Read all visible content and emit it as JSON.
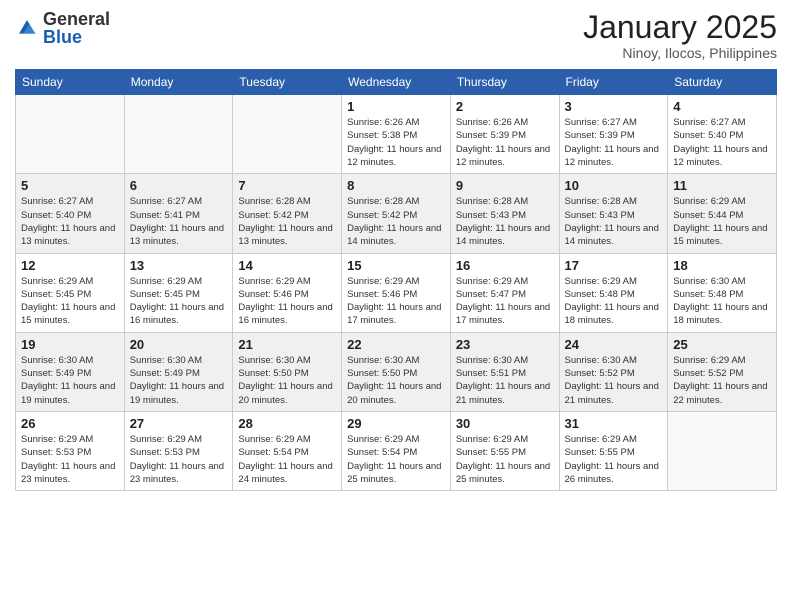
{
  "header": {
    "logo_general": "General",
    "logo_blue": "Blue",
    "month_title": "January 2025",
    "location": "Ninoy, Ilocos, Philippines"
  },
  "weekdays": [
    "Sunday",
    "Monday",
    "Tuesday",
    "Wednesday",
    "Thursday",
    "Friday",
    "Saturday"
  ],
  "weeks": [
    [
      {
        "day": "",
        "sunrise": "",
        "sunset": "",
        "daylight": ""
      },
      {
        "day": "",
        "sunrise": "",
        "sunset": "",
        "daylight": ""
      },
      {
        "day": "",
        "sunrise": "",
        "sunset": "",
        "daylight": ""
      },
      {
        "day": "1",
        "sunrise": "Sunrise: 6:26 AM",
        "sunset": "Sunset: 5:38 PM",
        "daylight": "Daylight: 11 hours and 12 minutes."
      },
      {
        "day": "2",
        "sunrise": "Sunrise: 6:26 AM",
        "sunset": "Sunset: 5:39 PM",
        "daylight": "Daylight: 11 hours and 12 minutes."
      },
      {
        "day": "3",
        "sunrise": "Sunrise: 6:27 AM",
        "sunset": "Sunset: 5:39 PM",
        "daylight": "Daylight: 11 hours and 12 minutes."
      },
      {
        "day": "4",
        "sunrise": "Sunrise: 6:27 AM",
        "sunset": "Sunset: 5:40 PM",
        "daylight": "Daylight: 11 hours and 12 minutes."
      }
    ],
    [
      {
        "day": "5",
        "sunrise": "Sunrise: 6:27 AM",
        "sunset": "Sunset: 5:40 PM",
        "daylight": "Daylight: 11 hours and 13 minutes."
      },
      {
        "day": "6",
        "sunrise": "Sunrise: 6:27 AM",
        "sunset": "Sunset: 5:41 PM",
        "daylight": "Daylight: 11 hours and 13 minutes."
      },
      {
        "day": "7",
        "sunrise": "Sunrise: 6:28 AM",
        "sunset": "Sunset: 5:42 PM",
        "daylight": "Daylight: 11 hours and 13 minutes."
      },
      {
        "day": "8",
        "sunrise": "Sunrise: 6:28 AM",
        "sunset": "Sunset: 5:42 PM",
        "daylight": "Daylight: 11 hours and 14 minutes."
      },
      {
        "day": "9",
        "sunrise": "Sunrise: 6:28 AM",
        "sunset": "Sunset: 5:43 PM",
        "daylight": "Daylight: 11 hours and 14 minutes."
      },
      {
        "day": "10",
        "sunrise": "Sunrise: 6:28 AM",
        "sunset": "Sunset: 5:43 PM",
        "daylight": "Daylight: 11 hours and 14 minutes."
      },
      {
        "day": "11",
        "sunrise": "Sunrise: 6:29 AM",
        "sunset": "Sunset: 5:44 PM",
        "daylight": "Daylight: 11 hours and 15 minutes."
      }
    ],
    [
      {
        "day": "12",
        "sunrise": "Sunrise: 6:29 AM",
        "sunset": "Sunset: 5:45 PM",
        "daylight": "Daylight: 11 hours and 15 minutes."
      },
      {
        "day": "13",
        "sunrise": "Sunrise: 6:29 AM",
        "sunset": "Sunset: 5:45 PM",
        "daylight": "Daylight: 11 hours and 16 minutes."
      },
      {
        "day": "14",
        "sunrise": "Sunrise: 6:29 AM",
        "sunset": "Sunset: 5:46 PM",
        "daylight": "Daylight: 11 hours and 16 minutes."
      },
      {
        "day": "15",
        "sunrise": "Sunrise: 6:29 AM",
        "sunset": "Sunset: 5:46 PM",
        "daylight": "Daylight: 11 hours and 17 minutes."
      },
      {
        "day": "16",
        "sunrise": "Sunrise: 6:29 AM",
        "sunset": "Sunset: 5:47 PM",
        "daylight": "Daylight: 11 hours and 17 minutes."
      },
      {
        "day": "17",
        "sunrise": "Sunrise: 6:29 AM",
        "sunset": "Sunset: 5:48 PM",
        "daylight": "Daylight: 11 hours and 18 minutes."
      },
      {
        "day": "18",
        "sunrise": "Sunrise: 6:30 AM",
        "sunset": "Sunset: 5:48 PM",
        "daylight": "Daylight: 11 hours and 18 minutes."
      }
    ],
    [
      {
        "day": "19",
        "sunrise": "Sunrise: 6:30 AM",
        "sunset": "Sunset: 5:49 PM",
        "daylight": "Daylight: 11 hours and 19 minutes."
      },
      {
        "day": "20",
        "sunrise": "Sunrise: 6:30 AM",
        "sunset": "Sunset: 5:49 PM",
        "daylight": "Daylight: 11 hours and 19 minutes."
      },
      {
        "day": "21",
        "sunrise": "Sunrise: 6:30 AM",
        "sunset": "Sunset: 5:50 PM",
        "daylight": "Daylight: 11 hours and 20 minutes."
      },
      {
        "day": "22",
        "sunrise": "Sunrise: 6:30 AM",
        "sunset": "Sunset: 5:50 PM",
        "daylight": "Daylight: 11 hours and 20 minutes."
      },
      {
        "day": "23",
        "sunrise": "Sunrise: 6:30 AM",
        "sunset": "Sunset: 5:51 PM",
        "daylight": "Daylight: 11 hours and 21 minutes."
      },
      {
        "day": "24",
        "sunrise": "Sunrise: 6:30 AM",
        "sunset": "Sunset: 5:52 PM",
        "daylight": "Daylight: 11 hours and 21 minutes."
      },
      {
        "day": "25",
        "sunrise": "Sunrise: 6:29 AM",
        "sunset": "Sunset: 5:52 PM",
        "daylight": "Daylight: 11 hours and 22 minutes."
      }
    ],
    [
      {
        "day": "26",
        "sunrise": "Sunrise: 6:29 AM",
        "sunset": "Sunset: 5:53 PM",
        "daylight": "Daylight: 11 hours and 23 minutes."
      },
      {
        "day": "27",
        "sunrise": "Sunrise: 6:29 AM",
        "sunset": "Sunset: 5:53 PM",
        "daylight": "Daylight: 11 hours and 23 minutes."
      },
      {
        "day": "28",
        "sunrise": "Sunrise: 6:29 AM",
        "sunset": "Sunset: 5:54 PM",
        "daylight": "Daylight: 11 hours and 24 minutes."
      },
      {
        "day": "29",
        "sunrise": "Sunrise: 6:29 AM",
        "sunset": "Sunset: 5:54 PM",
        "daylight": "Daylight: 11 hours and 25 minutes."
      },
      {
        "day": "30",
        "sunrise": "Sunrise: 6:29 AM",
        "sunset": "Sunset: 5:55 PM",
        "daylight": "Daylight: 11 hours and 25 minutes."
      },
      {
        "day": "31",
        "sunrise": "Sunrise: 6:29 AM",
        "sunset": "Sunset: 5:55 PM",
        "daylight": "Daylight: 11 hours and 26 minutes."
      },
      {
        "day": "",
        "sunrise": "",
        "sunset": "",
        "daylight": ""
      }
    ]
  ]
}
